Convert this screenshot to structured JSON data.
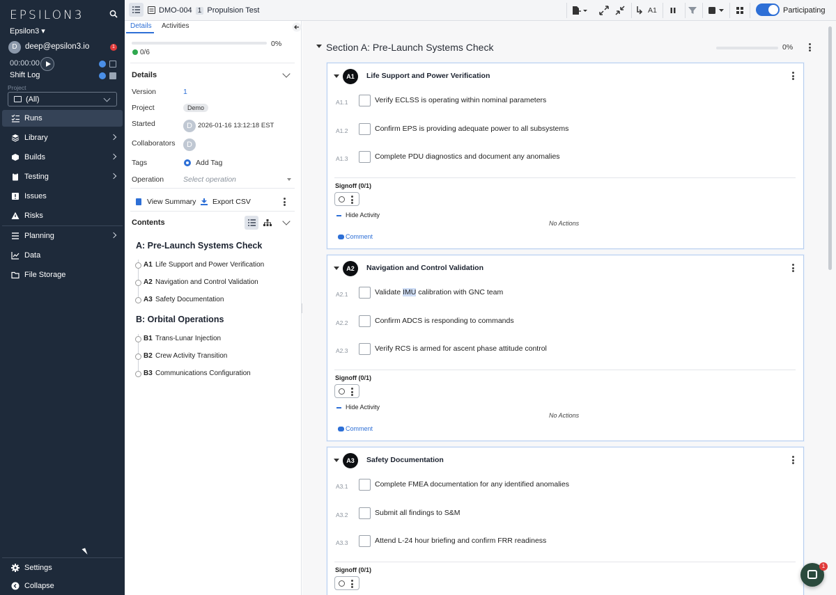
{
  "sidebar": {
    "logo": "EPSILON3",
    "org": "Epsilon3 ▾",
    "user_email": "deep@epsilon3.io",
    "user_initial": "D",
    "notif_count": "1",
    "timer": "00:00:00",
    "shift_log": "Shift Log",
    "project_label": "Project",
    "project_value": "(All)",
    "nav": {
      "runs": "Runs",
      "library": "Library",
      "builds": "Builds",
      "testing": "Testing",
      "issues": "Issues",
      "risks": "Risks",
      "planning": "Planning",
      "data": "Data",
      "file_storage": "File Storage",
      "settings": "Settings",
      "collapse": "Collapse"
    }
  },
  "topbar": {
    "run_id": "DMO-004",
    "revision": "1",
    "run_title": "Propulsion Test",
    "current_step": "A1",
    "participating_label": "Participating",
    "participating_on": true
  },
  "details_panel": {
    "tabs": [
      "Details",
      "Activities"
    ],
    "progress_pct": "0%",
    "done_count": "0/6",
    "details_title": "Details",
    "version_label": "Version",
    "version_value": "1",
    "project_label": "Project",
    "project_value": "Demo",
    "started_label": "Started",
    "started_initial": "D",
    "started_value": "2026-01-16 13:12:18 EST",
    "collaborators_label": "Collaborators",
    "collaborator_initial": "D",
    "tags_label": "Tags",
    "add_tag": "Add Tag",
    "operation_label": "Operation",
    "operation_placeholder": "Select operation",
    "view_summary": "View Summary",
    "export_csv": "Export CSV",
    "contents_title": "Contents",
    "toc": [
      {
        "heading": "A: Pre-Launch Systems Check",
        "items": [
          {
            "num": "A1",
            "label": "Life Support and Power Verification"
          },
          {
            "num": "A2",
            "label": "Navigation and Control Validation"
          },
          {
            "num": "A3",
            "label": "Safety Documentation"
          }
        ]
      },
      {
        "heading": "B: Orbital Operations",
        "items": [
          {
            "num": "B1",
            "label": "Trans-Lunar Injection"
          },
          {
            "num": "B2",
            "label": "Crew Activity Transition"
          },
          {
            "num": "B3",
            "label": "Communications Configuration"
          }
        ]
      }
    ]
  },
  "section": {
    "title": "Section A: Pre-Launch Systems Check",
    "progress_pct": "0%",
    "steps": [
      {
        "badge": "A1",
        "title": "Life Support and Power Verification",
        "substeps": [
          {
            "num": "A1.1",
            "text": "Verify ECLSS is operating within nominal parameters"
          },
          {
            "num": "A1.2",
            "text": "Confirm EPS is providing adequate power to all subsystems"
          },
          {
            "num": "A1.3",
            "text": "Complete PDU diagnostics and document any anomalies"
          }
        ],
        "signoff": "Signoff (0/1)",
        "hide_activity": "Hide Activity",
        "no_actions": "No Actions",
        "comment": "Comment"
      },
      {
        "badge": "A2",
        "title": "Navigation and Control Validation",
        "substeps": [
          {
            "num": "A2.1",
            "text_before": "Validate ",
            "text_highlight": "IMU",
            "text_after": " calibration with GNC team"
          },
          {
            "num": "A2.2",
            "text": "Confirm ADCS is responding to commands"
          },
          {
            "num": "A2.3",
            "text": "Verify RCS is armed for ascent phase attitude control"
          }
        ],
        "signoff": "Signoff (0/1)",
        "hide_activity": "Hide Activity",
        "no_actions": "No Actions",
        "comment": "Comment"
      },
      {
        "badge": "A3",
        "title": "Safety Documentation",
        "substeps": [
          {
            "num": "A3.1",
            "text": "Complete FMEA documentation for any identified anomalies"
          },
          {
            "num": "A3.2",
            "text": "Submit all findings to S&M"
          },
          {
            "num": "A3.3",
            "text": "Attend L-24 hour briefing and confirm FRR readiness"
          }
        ],
        "signoff": "Signoff (0/1)"
      }
    ]
  },
  "chat": {
    "badge": "1"
  },
  "colors": {
    "sidebar_bg": "#1e2a3a",
    "accent": "#2d6fd6",
    "done": "#2fa84f",
    "alert": "#e03b3b"
  }
}
